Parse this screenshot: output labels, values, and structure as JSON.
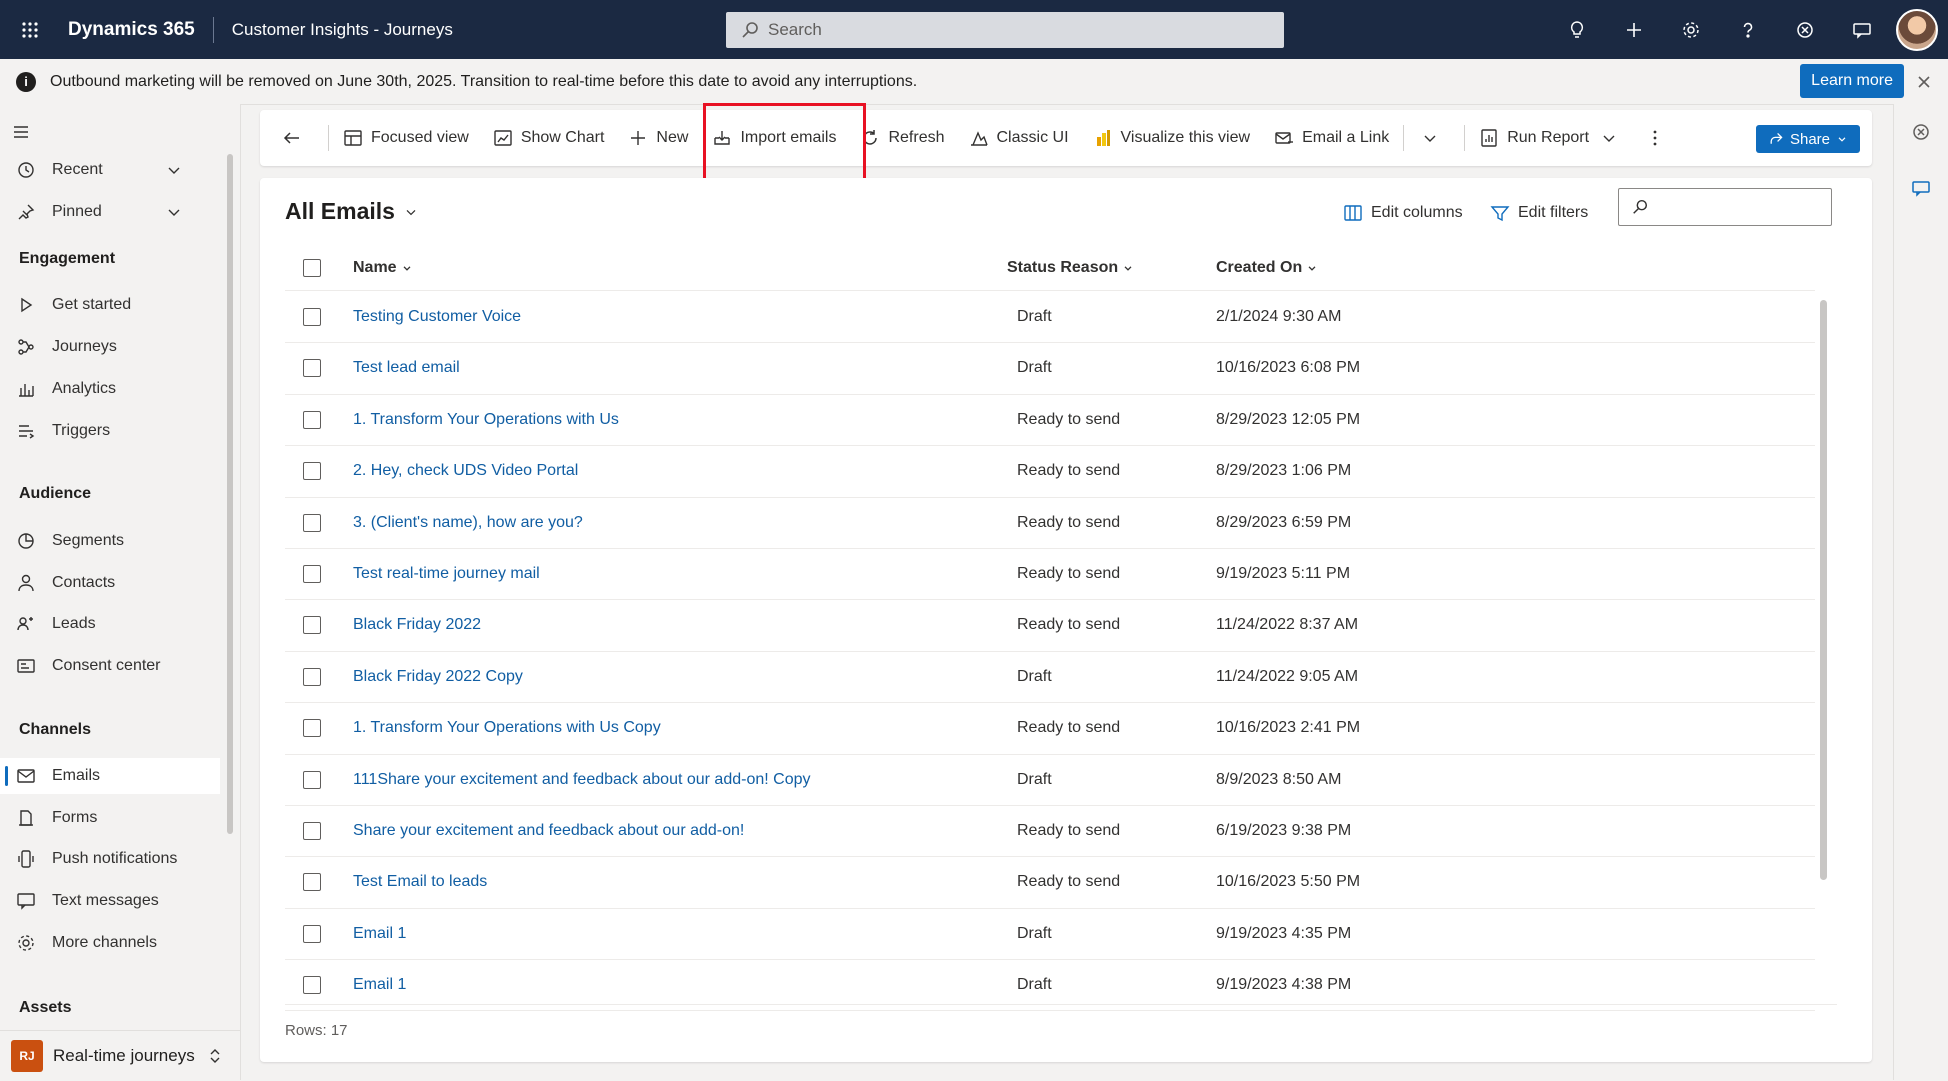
{
  "topbar": {
    "app_name": "Dynamics 365",
    "app_area": "Customer Insights - Journeys",
    "search_placeholder": "Search"
  },
  "notification": {
    "text": "Outbound marketing will be removed on June 30th, 2025. Transition to real-time before this date to avoid any interruptions.",
    "learn_more": "Learn more"
  },
  "nav": {
    "recent": "Recent",
    "pinned": "Pinned",
    "sections": {
      "engagement": "Engagement",
      "audience": "Audience",
      "channels": "Channels",
      "assets": "Assets"
    },
    "engagement": [
      "Get started",
      "Journeys",
      "Analytics",
      "Triggers"
    ],
    "audience": [
      "Segments",
      "Contacts",
      "Leads",
      "Consent center"
    ],
    "channels": [
      "Emails",
      "Forms",
      "Push notifications",
      "Text messages",
      "More channels"
    ],
    "selected": "Emails",
    "area": {
      "badge": "RJ",
      "label": "Real-time journeys"
    }
  },
  "commandbar": {
    "focused_view": "Focused view",
    "show_chart": "Show Chart",
    "new": "New",
    "import_emails": "Import emails",
    "refresh": "Refresh",
    "classic_ui": "Classic UI",
    "visualize": "Visualize this view",
    "email_link": "Email a Link",
    "run_report": "Run Report",
    "share": "Share"
  },
  "view": {
    "title": "All Emails",
    "edit_columns": "Edit columns",
    "edit_filters": "Edit filters",
    "columns": {
      "name": "Name",
      "status": "Status Reason",
      "created": "Created On"
    },
    "rows": [
      {
        "name": "Testing Customer Voice",
        "status": "Draft",
        "created": "2/1/2024 9:30 AM"
      },
      {
        "name": "Test lead email",
        "status": "Draft",
        "created": "10/16/2023 6:08 PM"
      },
      {
        "name": "1. Transform Your Operations with Us",
        "status": "Ready to send",
        "created": "8/29/2023 12:05 PM"
      },
      {
        "name": "2. Hey, check UDS Video Portal",
        "status": "Ready to send",
        "created": "8/29/2023 1:06 PM"
      },
      {
        "name": "3. (Client's name), how are you?",
        "status": "Ready to send",
        "created": "8/29/2023 6:59 PM"
      },
      {
        "name": "Test real-time journey mail",
        "status": "Ready to send",
        "created": "9/19/2023 5:11 PM"
      },
      {
        "name": "Black Friday 2022",
        "status": "Ready to send",
        "created": "11/24/2022 8:37 AM"
      },
      {
        "name": "Black Friday 2022 Copy",
        "status": "Draft",
        "created": "11/24/2022 9:05 AM"
      },
      {
        "name": "1. Transform Your Operations with Us Copy",
        "status": "Ready to send",
        "created": "10/16/2023 2:41 PM"
      },
      {
        "name": "111Share your excitement and feedback about our add-on! Copy",
        "status": "Draft",
        "created": "8/9/2023 8:50 AM"
      },
      {
        "name": "Share your excitement and feedback about our add-on!",
        "status": "Ready to send",
        "created": "6/19/2023 9:38 PM"
      },
      {
        "name": "Test Email to leads",
        "status": "Ready to send",
        "created": "10/16/2023 5:50 PM"
      },
      {
        "name": "Email 1",
        "status": "Draft",
        "created": "9/19/2023 4:35 PM"
      },
      {
        "name": "Email 1",
        "status": "Draft",
        "created": "9/19/2023 4:38 PM"
      }
    ],
    "rows_count": "Rows: 17"
  },
  "colors": {
    "topbar": "#1b2942",
    "accent": "#0f6cbd",
    "link": "#115ea3",
    "highlight": "#e81123",
    "area_badge": "#ca5010"
  }
}
